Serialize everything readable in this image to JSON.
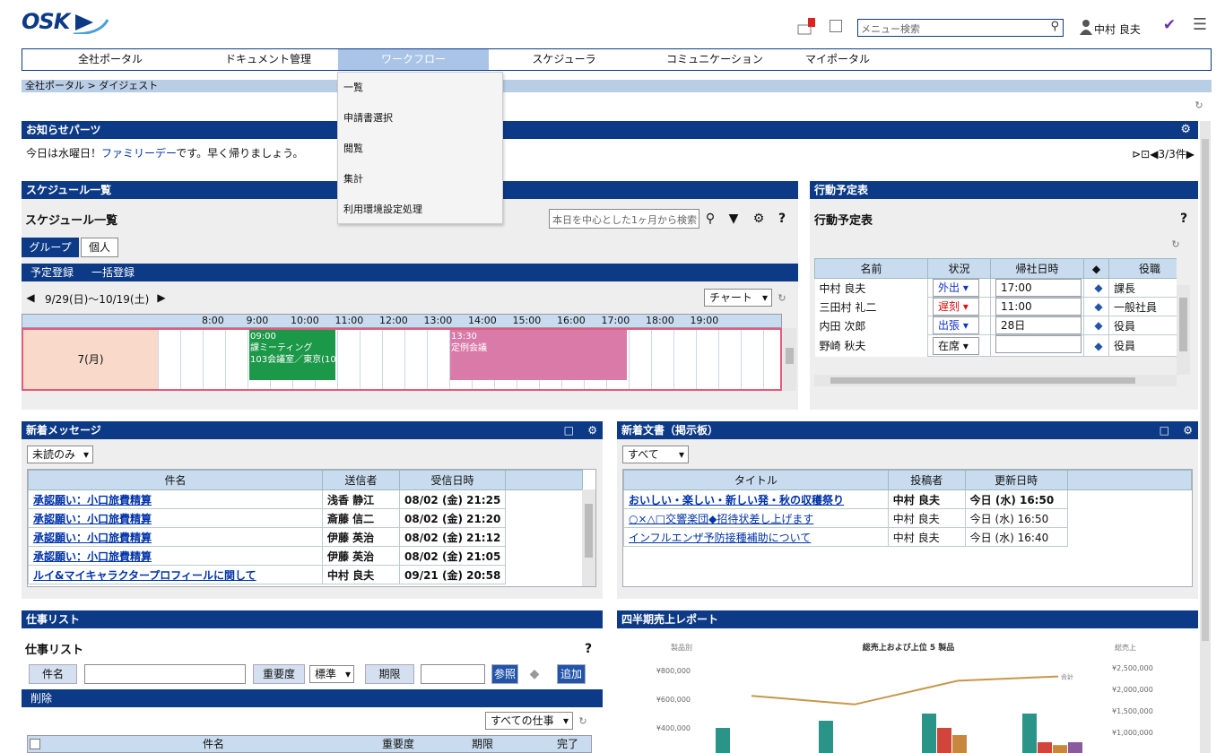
{
  "logo": "OSK",
  "header": {
    "search_placeholder": "メニュー検索",
    "user_name": "中村 良夫"
  },
  "nav": [
    "全社ポータル",
    "ドキュメント管理",
    "ワークフロー",
    "スケジューラ",
    "コミュニケーション",
    "マイポータル"
  ],
  "dropdown": [
    "一覧",
    "申請書選択",
    "閲覧",
    "集計",
    "利用環境設定処理"
  ],
  "breadcrumb": "全社ポータル > ダイジェスト",
  "notice": {
    "title": "お知らせパーツ",
    "text_pre": "今日は水曜日！",
    "text_link": "ファミリーデー",
    "text_post": "です。早く帰りましょう。",
    "counter": "◀3/3件▶"
  },
  "schedule": {
    "bar": "スケジュール一覧",
    "title": "スケジュール一覧",
    "search_placeholder": "本日を中心とした1ヶ月から検索",
    "tabs": [
      "グループ",
      "個人"
    ],
    "actions": [
      "予定登録",
      "一括登録"
    ],
    "range": "9/29(日)〜10/19(土)",
    "view": "チャート",
    "hours": [
      "8:00",
      "9:00",
      "10:00",
      "11:00",
      "12:00",
      "13:00",
      "14:00",
      "15:00",
      "16:00",
      "17:00",
      "18:00",
      "19:00"
    ],
    "day": "7(月)",
    "event1": {
      "time": "09:00",
      "title": "課ミーティング",
      "place": "103会議室／東京(10:"
    },
    "event2": {
      "time": "13:30",
      "title": "定例会議"
    }
  },
  "action": {
    "bar": "行動予定表",
    "title": "行動予定表",
    "headers": [
      "名前",
      "状況",
      "帰社日時",
      "",
      "役職"
    ],
    "rows": [
      {
        "name": "中村 良夫",
        "status": "外出",
        "status_color": "#1133cc",
        "time": "17:00",
        "role": "課長"
      },
      {
        "name": "三田村 礼二",
        "status": "遅刻",
        "status_color": "#dd1111",
        "time": "11:00",
        "role": "一般社員"
      },
      {
        "name": "内田 次郎",
        "status": "出張",
        "status_color": "#1133cc",
        "time": "28日",
        "role": "役員"
      },
      {
        "name": "野崎 秋夫",
        "status": "在席",
        "status_color": "#111111",
        "time": "",
        "role": "役員"
      }
    ]
  },
  "messages": {
    "bar": "新着メッセージ",
    "filter": "未読のみ",
    "headers": [
      "件名",
      "送信者",
      "受信日時"
    ],
    "rows": [
      [
        "承認願い：小口旅費精算",
        "浅香 静江",
        "08/02 (金) 21:25"
      ],
      [
        "承認願い：小口旅費精算",
        "斎藤 信二",
        "08/02 (金) 21:20"
      ],
      [
        "承認願い：小口旅費精算",
        "伊藤 英治",
        "08/02 (金) 21:12"
      ],
      [
        "承認願い：小口旅費精算",
        "伊藤 英治",
        "08/02 (金) 21:05"
      ],
      [
        "ルイ&マイキャラクタープロフィールに関して",
        "中村 良夫",
        "09/21 (金) 20:58"
      ]
    ]
  },
  "docs": {
    "bar": "新着文書（掲示板）",
    "filter": "すべて",
    "headers": [
      "タイトル",
      "投稿者",
      "更新日時"
    ],
    "rows": [
      [
        "おいしい・楽しい・新しい発・秋の収穫祭り",
        "中村 良夫",
        "今日 (水) 16:50"
      ],
      [
        "○×△□交響楽団◆招待状差し上げます",
        "中村 良夫",
        "今日 (水) 16:50"
      ],
      [
        "インフルエンザ予防接種補助について",
        "中村 良夫",
        "今日 (水) 16:40"
      ]
    ]
  },
  "tasks": {
    "bar": "仕事リスト",
    "title": "仕事リスト",
    "subject_label": "件名",
    "priority_label": "重要度",
    "priority_value": "標準",
    "deadline_label": "期限",
    "ref_label": "参照",
    "add_label": "追加",
    "delete_label": "削除",
    "filter": "すべての仕事",
    "headers": [
      "件名",
      "重要度",
      "期限",
      "完了"
    ]
  },
  "report": {
    "bar": "四半期売上レポート"
  },
  "chart_data": {
    "type": "bar",
    "title": "総売上および上位 5 製品",
    "ylabel": "製品別",
    "y2label": "総売上",
    "yticks": [
      "¥800,000",
      "¥600,000",
      "¥400,000"
    ],
    "y2ticks": [
      "¥2,500,000",
      "¥2,000,000",
      "¥1,500,000",
      "¥1,000,000"
    ],
    "line_label": "合計",
    "line_values": [
      1850000,
      1650000,
      2200000,
      2300000
    ],
    "series": [
      {
        "color": "#2a9488",
        "values": [
          400000,
          450000,
          500000,
          500000
        ]
      },
      {
        "color": "#d2453a",
        "values": [
          0,
          0,
          400000,
          300000
        ]
      },
      {
        "color": "#c9863d",
        "values": [
          0,
          0,
          350000,
          280000
        ]
      },
      {
        "color": "#8a5a9e",
        "values": [
          0,
          0,
          0,
          300000
        ]
      }
    ],
    "colors": {
      "line": "#c8964a"
    }
  }
}
